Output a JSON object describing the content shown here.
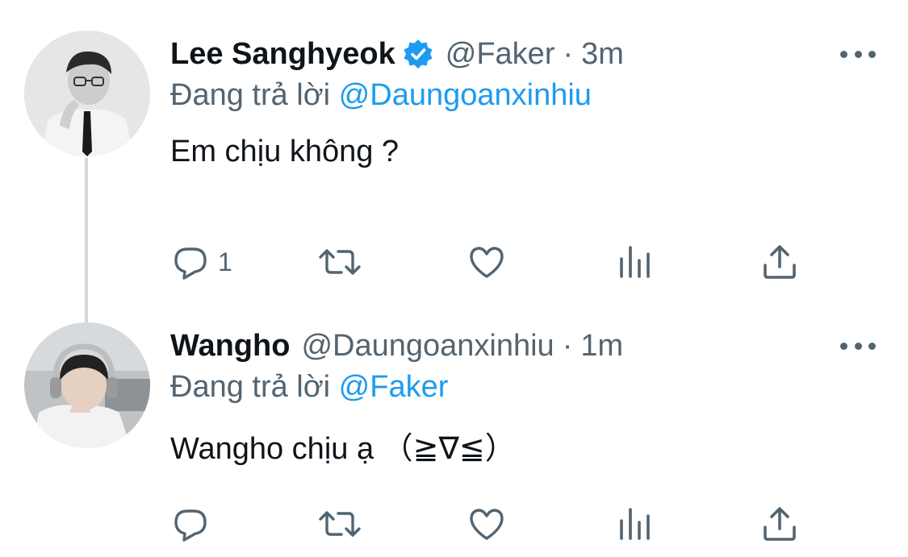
{
  "tweets": [
    {
      "name": "Lee Sanghyeok",
      "verified": true,
      "handle": "@Faker",
      "separator": "·",
      "time": "3m",
      "reply_prefix": "Đang trả lời",
      "reply_to": "@Daungoanxinhiu",
      "text": "Em chịu không ?",
      "reply_count": "1",
      "avatar_icon": "person-in-suit-avatar"
    },
    {
      "name": "Wangho",
      "verified": false,
      "handle": "@Daungoanxinhiu",
      "separator": "·",
      "time": "1m",
      "reply_prefix": "Đang trả lời",
      "reply_to": "@Faker",
      "text": "Wangho chịu ạ （≧∇≦）",
      "reply_count": "",
      "avatar_icon": "person-with-headset-avatar"
    }
  ],
  "actions": [
    "reply-icon",
    "retweet-icon",
    "like-icon",
    "views-icon",
    "share-icon"
  ],
  "colors": {
    "accent": "#1d9bf0",
    "secondary_text": "#536471",
    "primary_text": "#0f1419",
    "thread_line": "#cfd9de"
  }
}
